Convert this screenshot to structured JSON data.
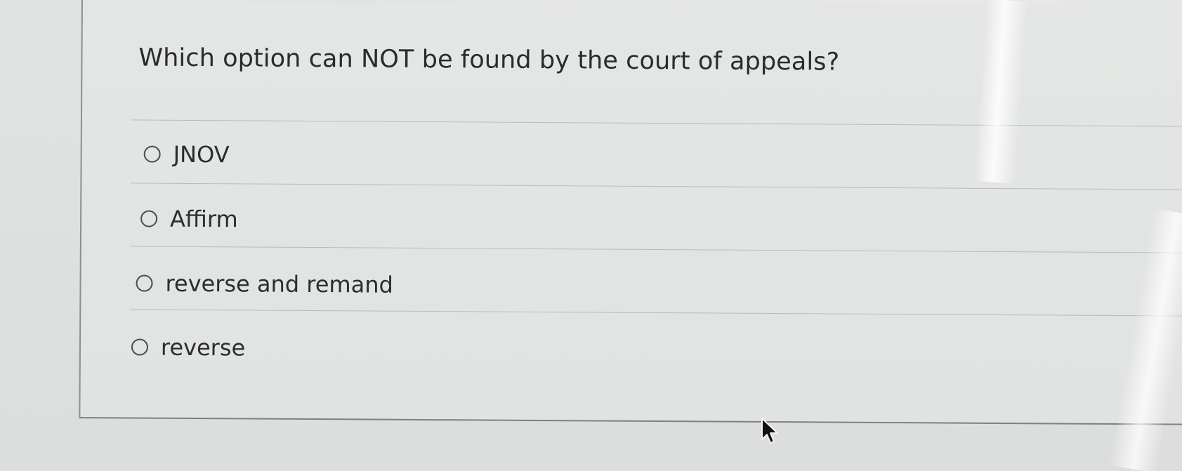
{
  "question": {
    "text": "Which option can NOT be found by the court of appeals?"
  },
  "options": [
    {
      "label": "JNOV",
      "selected": false
    },
    {
      "label": "Affirm",
      "selected": false
    },
    {
      "label": "reverse and remand",
      "selected": false
    },
    {
      "label": "reverse",
      "selected": false
    }
  ],
  "icons": {
    "radio": "radio-button-unselected-icon",
    "cursor": "mouse-pointer-icon"
  },
  "colors": {
    "text": "#2a2b2b",
    "background": "#dfe1e0",
    "divider": "#b9bcbb",
    "border": "#8d8f8e"
  }
}
